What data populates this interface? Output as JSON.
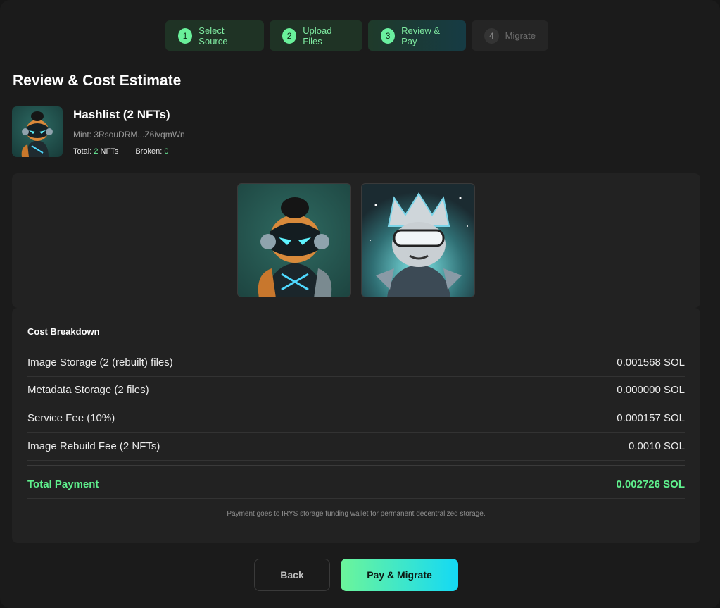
{
  "stepper": {
    "steps": [
      {
        "num": "1",
        "label": "Select Source"
      },
      {
        "num": "2",
        "label": "Upload Files"
      },
      {
        "num": "3",
        "label": "Review & Pay"
      },
      {
        "num": "4",
        "label": "Migrate"
      }
    ]
  },
  "page": {
    "title": "Review & Cost Estimate"
  },
  "collection": {
    "name": "Hashlist (2 NFTs)",
    "mint": "Mint: 3RsouDRM...Z6ivqmWn",
    "total_label": "Total:",
    "total_value": "2",
    "total_suffix": "NFTs",
    "broken_label": "Broken:",
    "broken_value": "0"
  },
  "cost": {
    "heading": "Cost Breakdown",
    "rows": [
      {
        "label": "Image Storage (2 (rebuilt) files)",
        "value": "0.001568 SOL"
      },
      {
        "label": "Metadata Storage (2 files)",
        "value": "0.000000 SOL"
      },
      {
        "label": "Service Fee (10%)",
        "value": "0.000157 SOL"
      },
      {
        "label": "Image Rebuild Fee (2 NFTs)",
        "value": "0.0010 SOL"
      }
    ],
    "total_label": "Total Payment",
    "total_value": "0.002726 SOL",
    "note": "Payment goes to IRYS storage funding wallet for permanent decentralized storage."
  },
  "actions": {
    "back": "Back",
    "pay": "Pay & Migrate"
  },
  "colors": {
    "accent": "#5ff08d",
    "cyan": "#14d9f5",
    "background": "#1b1b1b"
  }
}
